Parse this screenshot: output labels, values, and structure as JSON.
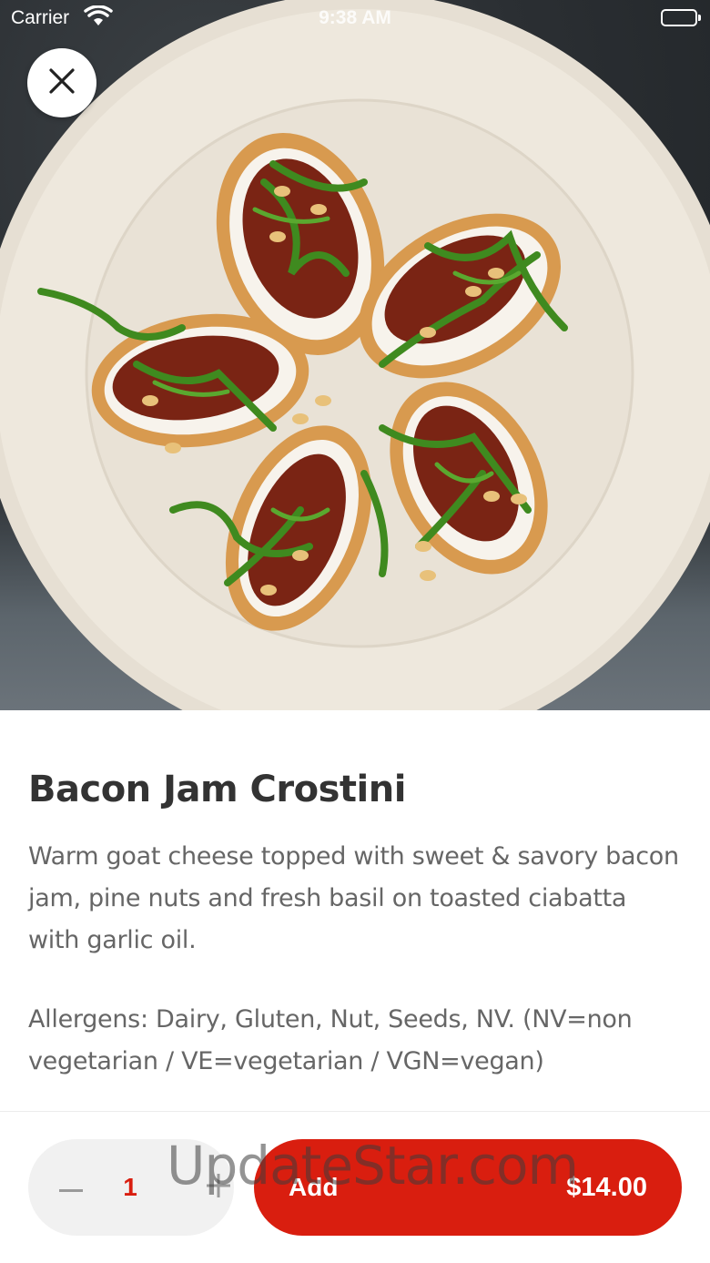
{
  "status_bar": {
    "carrier": "Carrier",
    "time": "9:38 AM"
  },
  "hero": {
    "image_alt": "Bacon Jam Crostini",
    "close_icon": "close-icon"
  },
  "item": {
    "title": "Bacon Jam Crostini",
    "description": "Warm goat cheese topped with sweet & savory bacon jam, pine nuts and fresh basil on toasted ciabatta with garlic oil.",
    "allergens": "Allergens: Dairy, Gluten, Nut, Seeds, NV. (NV=non vegetarian / VE=vegetarian / VGN=vegan)"
  },
  "order": {
    "quantity": "1",
    "decrement_icon": "minus-icon",
    "increment_icon": "plus-icon",
    "add_label": "Add",
    "price": "$14.00"
  },
  "watermark": "UpdateStar.com",
  "colors": {
    "accent": "#d91e0f",
    "title": "#333333",
    "body_text": "#666666",
    "stepper_bg": "#f1f1f1"
  }
}
